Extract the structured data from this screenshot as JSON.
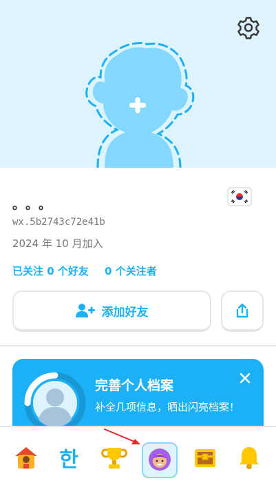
{
  "header": {
    "settings_icon": "gear-icon",
    "avatar_icon": "add-avatar-icon",
    "colors": {
      "background": "#ddf4ff",
      "avatar": "#84d8ff",
      "outline": "#1cb0f6"
    }
  },
  "profile": {
    "name": "。。。",
    "username": "wx.5b2743c72e41b",
    "joined": "2024 年 10 月加入",
    "flag_icon": "south-korea-flag-icon",
    "following": "已关注 0 个好友",
    "followers": "0 个关注者"
  },
  "actions": {
    "add_friend_label": "添加好友",
    "add_friend_icon": "add-user-icon",
    "share_icon": "share-icon"
  },
  "promo_card": {
    "title": "完善个人档案",
    "description": "补全几项信息，晒出闪亮档案！",
    "close_icon": "close-icon",
    "progress_icon": "profile-progress-icon",
    "color": "#1cb0f6"
  },
  "tabbar": {
    "items": [
      {
        "id": "home",
        "icon": "home-icon"
      },
      {
        "id": "letters",
        "label": "한"
      },
      {
        "id": "leaderboard",
        "icon": "trophy-icon"
      },
      {
        "id": "profile",
        "icon": "profile-avatar-icon",
        "active": true
      },
      {
        "id": "chest",
        "icon": "treasure-chest-icon"
      },
      {
        "id": "notifications",
        "icon": "bell-icon"
      }
    ]
  }
}
